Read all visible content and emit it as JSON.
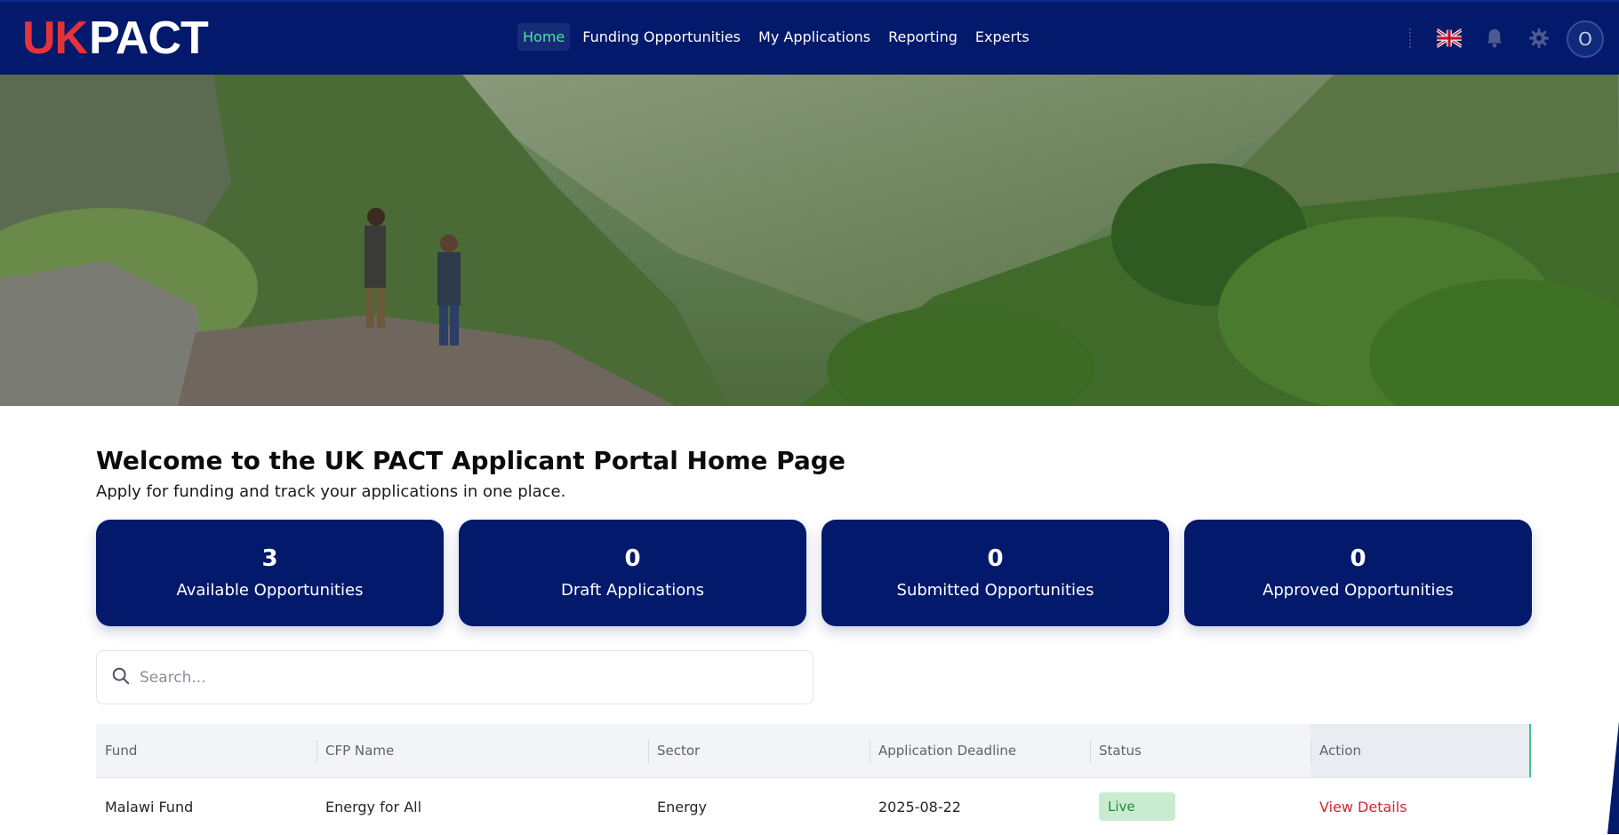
{
  "header": {
    "logo_uk": "UK",
    "logo_pact": "PACT",
    "nav": [
      {
        "label": "Home",
        "active": true
      },
      {
        "label": "Funding Opportunities",
        "active": false
      },
      {
        "label": "My Applications",
        "active": false
      },
      {
        "label": "Reporting",
        "active": false
      },
      {
        "label": "Experts",
        "active": false
      }
    ],
    "language_icon": "uk-flag-icon",
    "notification_icon": "bell-icon",
    "settings_icon": "gear-icon",
    "avatar_initial": "O"
  },
  "main": {
    "title": "Welcome to the UK PACT Applicant Portal Home Page",
    "subtitle": "Apply for funding and track your applications in one place.",
    "stats": [
      {
        "value": "3",
        "label": "Available Opportunities"
      },
      {
        "value": "0",
        "label": "Draft Applications"
      },
      {
        "value": "0",
        "label": "Submitted Opportunities"
      },
      {
        "value": "0",
        "label": "Approved Opportunities"
      }
    ],
    "search": {
      "placeholder": "Search..."
    },
    "table": {
      "columns": [
        "Fund",
        "CFP Name",
        "Sector",
        "Application Deadline",
        "Status",
        "Action"
      ],
      "rows": [
        {
          "fund": "Malawi Fund",
          "cfp_name": "Energy for All",
          "sector": "Energy",
          "deadline": "2025-08-22",
          "status": "Live",
          "action": "View Details"
        }
      ]
    }
  },
  "colors": {
    "brand_navy": "#03196b",
    "brand_red": "#e3343a",
    "active_nav": "#4ee3a0",
    "status_live_bg": "#c9ecd1",
    "status_live_text": "#1f8a3b",
    "action_link": "#d3252c"
  }
}
